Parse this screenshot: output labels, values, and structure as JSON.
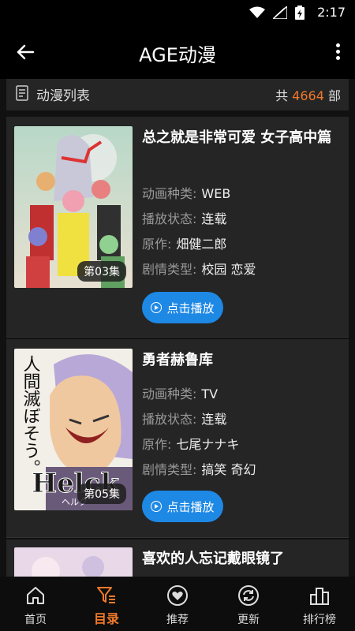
{
  "status_bar": {
    "time": "2:17",
    "icons": [
      "wifi-icon",
      "signal-icon",
      "battery-icon"
    ]
  },
  "app_bar": {
    "title": "AGE动漫"
  },
  "list_header": {
    "title": "动漫列表",
    "count_prefix": "共",
    "count": "4664",
    "count_suffix": "部"
  },
  "labels": {
    "type": "动画种类:",
    "status": "播放状态:",
    "author": "原作:",
    "genre": "剧情类型:",
    "play": "点击播放"
  },
  "items": [
    {
      "title": "总之就是非常可爱 女子高中篇",
      "episode": "第03集",
      "type": "WEB",
      "status": "连载",
      "author": "畑健二郎",
      "genre": "校园 恋爱"
    },
    {
      "title": "勇者赫鲁库",
      "episode": "第05集",
      "type": "TV",
      "status": "连载",
      "author": "七尾ナナキ",
      "genre": "搞笑 奇幻"
    },
    {
      "title": "喜欢的人忘记戴眼镜了"
    }
  ],
  "poster_text": {
    "helck_vertical": "人間滅ぼそう。",
    "helck_logo": "Helck",
    "helck_sub": "ヘルク"
  },
  "bottom_nav": [
    {
      "label": "首页",
      "icon": "home-icon"
    },
    {
      "label": "目录",
      "icon": "filter-list-icon",
      "active": true
    },
    {
      "label": "推荐",
      "icon": "heart-icon"
    },
    {
      "label": "更新",
      "icon": "refresh-icon"
    },
    {
      "label": "排行榜",
      "icon": "ranking-icon"
    }
  ],
  "colors": {
    "accent": "#f07a2b",
    "button": "#1e88e5",
    "background": "#1c1c1c",
    "card": "#252525"
  }
}
